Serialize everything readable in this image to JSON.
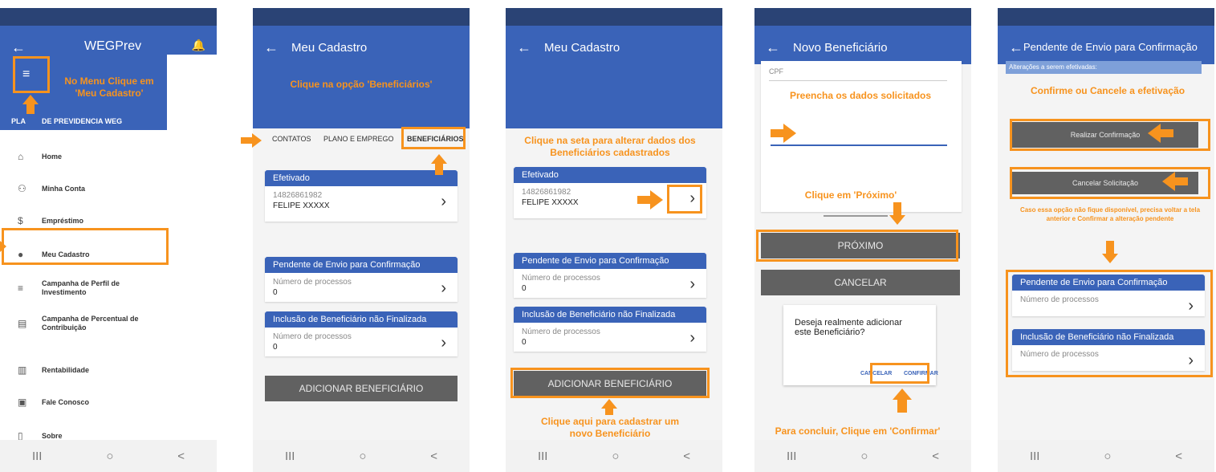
{
  "screen1": {
    "app_title": "WEGPrev",
    "plan_label": "DE PREVIDENCIA WEG",
    "plan_prefix": "PLA",
    "menu_items": [
      {
        "label": "Home",
        "icon": "home-icon"
      },
      {
        "label": "Minha Conta",
        "icon": "account-icon"
      },
      {
        "label": "Empréstimo",
        "icon": "dollar-icon"
      },
      {
        "label": "Meu Cadastro",
        "icon": "person-icon"
      },
      {
        "label": "Campanha de Perfil de Investimento",
        "icon": "list-edit-icon"
      },
      {
        "label": "Campanha de Percentual de Contribuição",
        "icon": "document-icon"
      },
      {
        "label": "Rentabilidade",
        "icon": "chart-icon"
      },
      {
        "label": "Fale Conosco",
        "icon": "contact-icon"
      },
      {
        "label": "Sobre",
        "icon": "phone-icon"
      }
    ],
    "annotation": "No Menu Clique em 'Meu Cadastro'"
  },
  "screen2": {
    "title": "Meu Cadastro",
    "annotation": "Clique na opção 'Beneficiários'",
    "tabs": [
      "CONTATOS",
      "PLANO E EMPREGO",
      "BENEFICIÁRIOS"
    ],
    "card_efetivado": {
      "header": "Efetivado",
      "cpf": "14826861982",
      "name": "FELIPE XXXXX"
    },
    "card_pendente": {
      "header": "Pendente de Envio para Confirmação",
      "label": "Número de processos",
      "value": "0"
    },
    "card_inclusao": {
      "header": "Inclusão de Beneficiário não Finalizada",
      "label": "Número de processos",
      "value": "0"
    },
    "add_button": "ADICIONAR BENEFICIÁRIO"
  },
  "screen3": {
    "title": "Meu Cadastro",
    "annotation_top": "Clique na seta para alterar dados dos Beneficiários cadastrados",
    "annotation_bottom": "Clique aqui para cadastrar um novo Beneficiário",
    "card_efetivado": {
      "header": "Efetivado",
      "cpf": "14826861982",
      "name": "FELIPE XXXXX"
    },
    "card_pendente": {
      "header": "Pendente de Envio para Confirmação",
      "label": "Número de processos",
      "value": "0"
    },
    "card_inclusao": {
      "header": "Inclusão de Beneficiário não Finalizada",
      "label": "Número de processos",
      "value": "0"
    },
    "add_button": "ADICIONAR BENEFICIÁRIO"
  },
  "screen4": {
    "title": "Novo Beneficiário",
    "field_label": "CPF",
    "annotation_fill": "Preencha os dados solicitados",
    "annotation_next": "Clique em 'Próximo'",
    "next_button": "PRÓXIMO",
    "cancel_button": "CANCELAR",
    "dialog_text": "Deseja realmente adicionar este Beneficiário?",
    "dialog_cancel": "CANCELAR",
    "dialog_confirm": "CONFIRMAR",
    "annotation_confirm": "Para concluir, Clique em 'Confirmar'"
  },
  "screen5": {
    "title": "Pendente de Envio para Confirmação",
    "changes_label": "Alterações a serem efetivadas:",
    "annotation_top": "Confirme ou Cancele a efetivação",
    "confirm_button": "Realizar Confirmação",
    "cancel_button": "Cancelar Solicitação",
    "annotation_note": "Caso essa opção não fique disponível, precisa voltar a tela anterior e Confirmar a alteração pendente",
    "card_pendente": {
      "header": "Pendente de Envio para Confirmação",
      "label": "Número de processos"
    },
    "card_inclusao": {
      "header": "Inclusão de Beneficiário não Finalizada",
      "label": "Número de processos"
    }
  },
  "navbar": {
    "recent": "III",
    "home": "○",
    "back": "<"
  },
  "colors": {
    "app_blue": "#3a63b8",
    "status_blue": "#2a4375",
    "annotation_orange": "#f7931e",
    "button_gray": "#616161"
  }
}
